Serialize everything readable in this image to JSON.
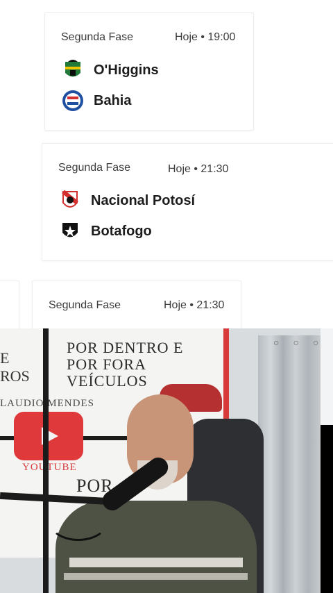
{
  "matches": [
    {
      "phase": "Segunda Fase",
      "time": "Hoje • 19:00",
      "home": {
        "name": "O'Higgins",
        "crest_colors": [
          "#1f7a3a",
          "#f2c400",
          "#0d0d0d"
        ]
      },
      "away": {
        "name": "Bahia",
        "crest_colors": [
          "#1f4fa0",
          "#d32f2f",
          "#ffffff"
        ]
      }
    },
    {
      "phase": "Segunda Fase",
      "time": "Hoje • 21:30",
      "home": {
        "name": "Nacional Potosí",
        "crest_colors": [
          "#d32f2f",
          "#ffffff",
          "#111111"
        ]
      },
      "away": {
        "name": "Botafogo",
        "crest_colors": [
          "#111111",
          "#ffffff"
        ]
      }
    },
    {
      "phase": "Segunda Fase",
      "time": "Hoje • 21:30"
    }
  ],
  "video": {
    "banner_title_line1": "POR DENTRO E",
    "banner_title_line2": "POR FORA VEÍCULOS",
    "banner_name": "LAUDIO MENDES",
    "banner_left_line1": "E",
    "banner_left_line2": "ROS",
    "youtube_label": "YOUTUBE",
    "banner_lower": "POR"
  }
}
